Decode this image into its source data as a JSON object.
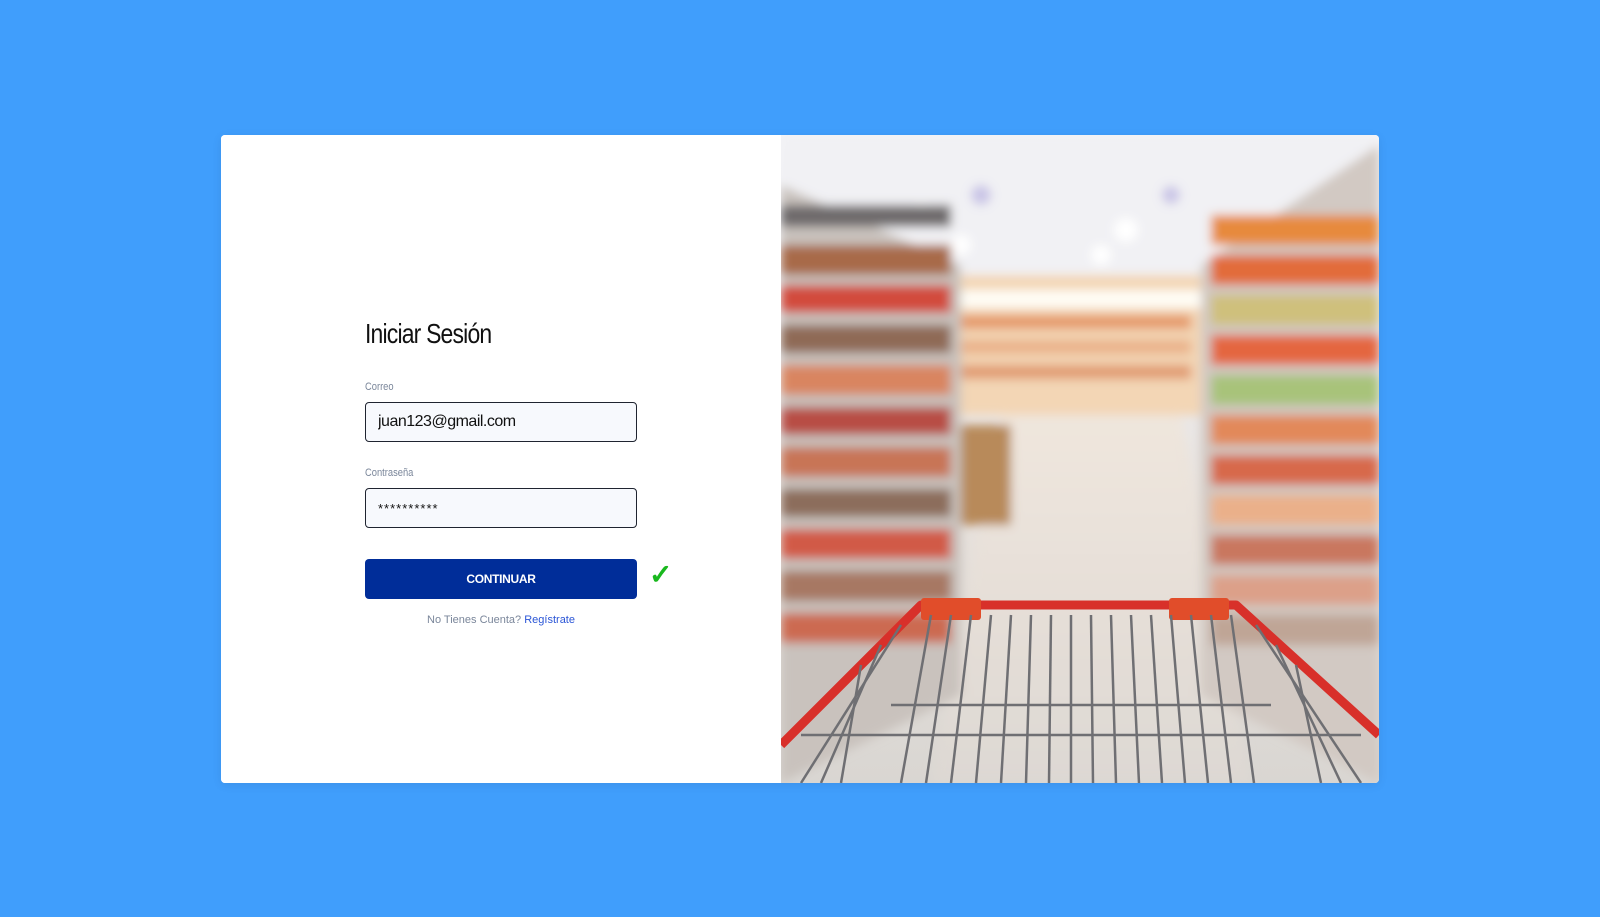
{
  "login": {
    "title": "Iniciar Sesión",
    "email_label": "Correo",
    "email_value": "juan123@gmail.com",
    "password_label": "Contraseña",
    "password_value": "**********",
    "submit_label": "CONTINUAR",
    "success_mark": "✓",
    "signup_prompt": "No Tienes Cuenta?",
    "signup_link": "Regístrate"
  },
  "hero_image": {
    "description_icon": "supermarket-cart-photo"
  },
  "colors": {
    "background": "#409efc",
    "button": "#002d99",
    "success": "#19b81e",
    "link": "#2a55d6"
  }
}
